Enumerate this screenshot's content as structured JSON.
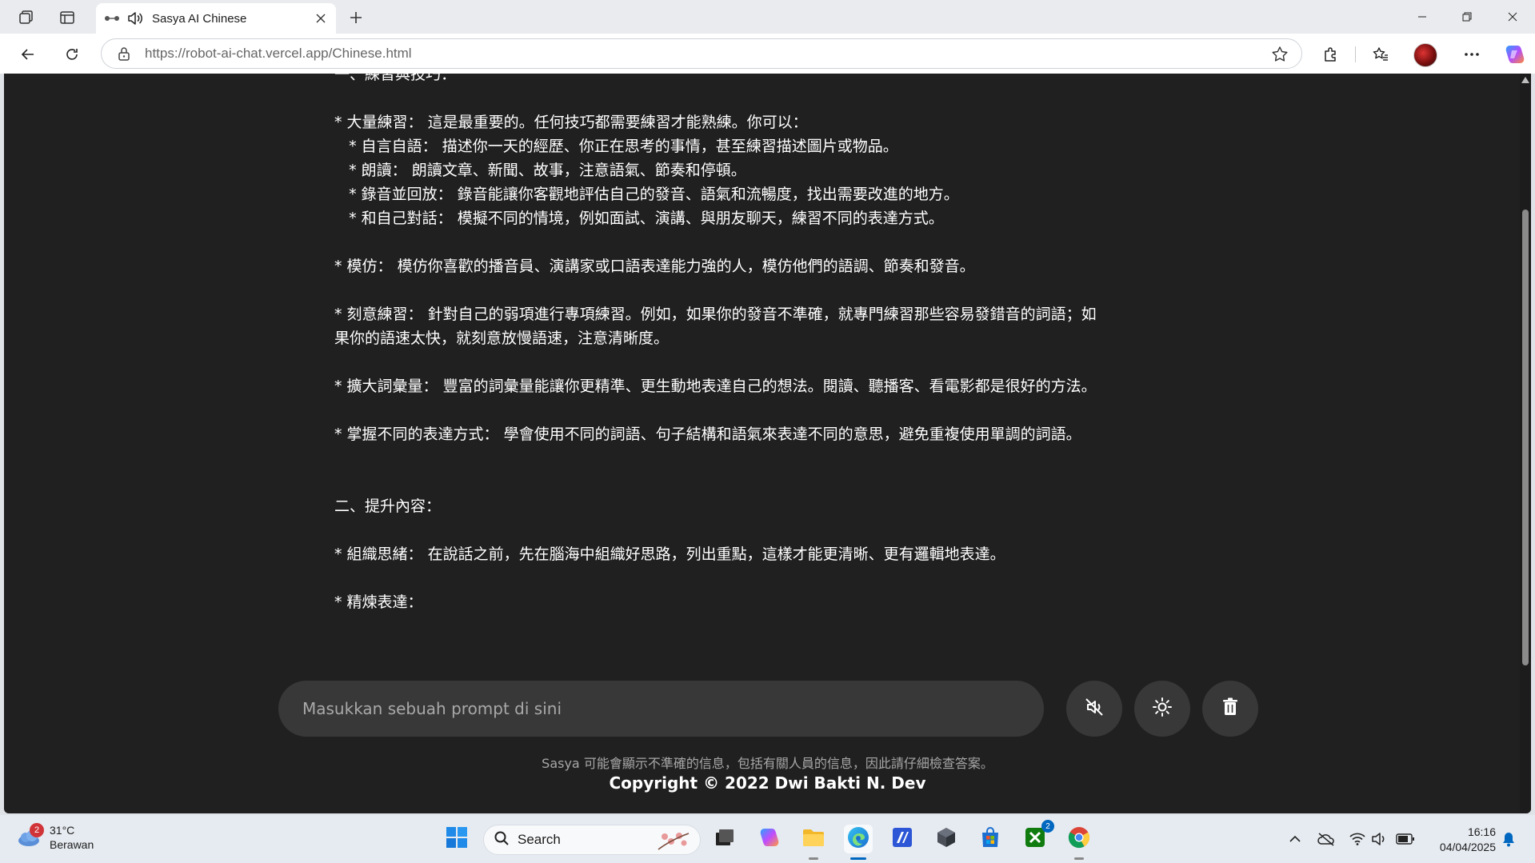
{
  "browser": {
    "tab_title": "Sasya AI Chinese",
    "url_host": "https://robot-ai-chat.vercel.app",
    "url_path": "/Chinese.html"
  },
  "chat": {
    "lines": [
      "一、練習與技巧：",
      "",
      "* 大量練習： 這是最重要的。任何技巧都需要練習才能熟練。你可以：",
      "   * 自言自語： 描述你一天的經歷、你正在思考的事情，甚至練習描述圖片或物品。",
      "   * 朗讀： 朗讀文章、新聞、故事，注意語氣、節奏和停頓。",
      "   * 錄音並回放： 錄音能讓你客觀地評估自己的發音、語氣和流暢度，找出需要改進的地方。",
      "   * 和自己對話： 模擬不同的情境，例如面試、演講、與朋友聊天，練習不同的表達方式。",
      "",
      "* 模仿： 模仿你喜歡的播音員、演講家或口語表達能力強的人，模仿他們的語調、節奏和發音。",
      "",
      "* 刻意練習： 針對自己的弱項進行專項練習。例如，如果你的發音不準確，就專門練習那些容易發錯音的詞語；如",
      "果你的語速太快，就刻意放慢語速，注意清晰度。",
      "",
      "* 擴大詞彙量： 豐富的詞彙量能讓你更精準、更生動地表達自己的想法。閱讀、聽播客、看電影都是很好的方法。",
      "",
      "* 掌握不同的表達方式： 學會使用不同的詞語、句子結構和語氣來表達不同的意思，避免重複使用單調的詞語。",
      "",
      "",
      "二、提升內容：",
      "",
      "* 組織思緒： 在說話之前，先在腦海中組織好思路，列出重點，這樣才能更清晰、更有邏輯地表達。",
      "",
      "* 精煉表達："
    ]
  },
  "input": {
    "placeholder": "Masukkan sebuah prompt di sini"
  },
  "footer": {
    "disclaimer": "Sasya 可能會顯示不準確的信息，包括有關人員的信息，因此請仔細檢查答案。",
    "copyright": "Copyright © 2022 Dwi Bakti N. Dev"
  },
  "taskbar": {
    "weather_temp": "31°C",
    "weather_desc": "Berawan",
    "weather_badge": "2",
    "search_label": "Search",
    "xbox_badge": "2",
    "time": "16:16",
    "date": "04/04/2025"
  },
  "colors": {
    "page_bg": "#202020",
    "input_bg": "#383838",
    "accent": "#0067c0"
  },
  "icons": [
    "workspaces-icon",
    "vertical-tabs-icon",
    "audio-icon",
    "close-icon",
    "new-tab-icon",
    "back-icon",
    "refresh-icon",
    "lock-icon",
    "favorite-star-icon",
    "extensions-icon",
    "favorites-icon",
    "more-icon",
    "copilot-icon",
    "mute-icon",
    "theme-toggle-icon",
    "trash-icon",
    "search-icon",
    "chevron-up-icon",
    "onedrive-icon",
    "wifi-icon",
    "volume-icon",
    "battery-icon",
    "bell-icon"
  ]
}
